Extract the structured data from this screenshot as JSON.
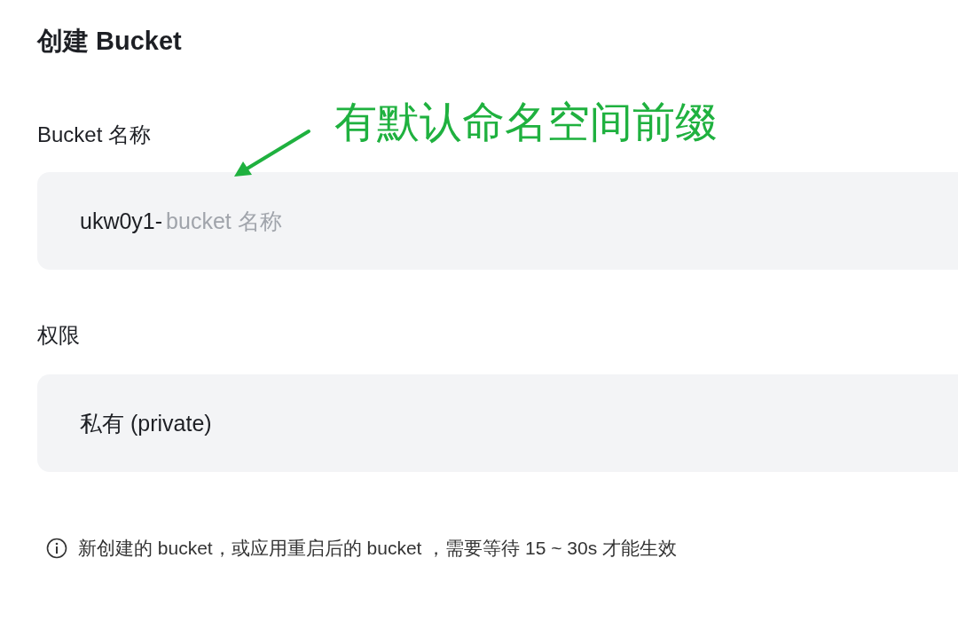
{
  "title": "创建 Bucket",
  "annotation": {
    "text": "有默认命名空间前缀"
  },
  "fields": [
    {
      "kind": "text",
      "label": "Bucket 名称",
      "prefix": "ukw0y1-",
      "placeholder": "bucket 名称"
    },
    {
      "kind": "select",
      "label": "权限",
      "value": "私有 (private)"
    }
  ],
  "hint": "新创建的 bucket，或应用重启后的 bucket ，需要等待 15 ~ 30s 才能生效"
}
